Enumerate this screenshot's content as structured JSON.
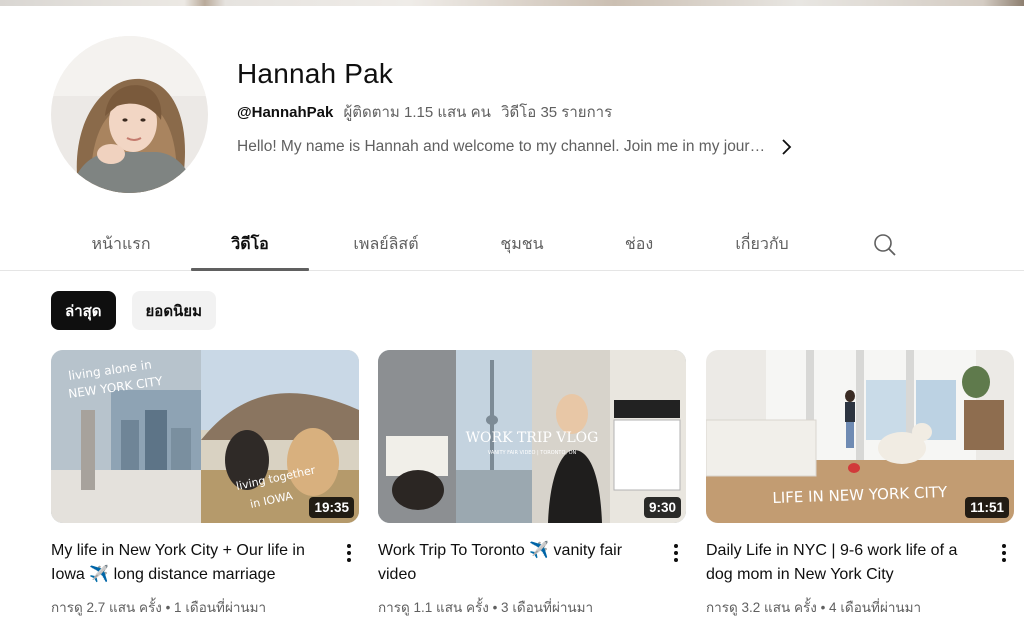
{
  "channel": {
    "name": "Hannah Pak",
    "handle": "@HannahPak",
    "subscribers": "ผู้ติดตาม 1.15 แสน คน",
    "video_count": "วิดีโอ 35 รายการ",
    "description": "Hello! My name is Hannah and welcome to my channel. Join me in my jour…"
  },
  "tabs": [
    {
      "label": "หน้าแรก"
    },
    {
      "label": "วิดีโอ",
      "active": true
    },
    {
      "label": "เพลย์ลิสต์"
    },
    {
      "label": "ชุมชน"
    },
    {
      "label": "ช่อง"
    },
    {
      "label": "เกี่ยวกับ"
    }
  ],
  "chips": [
    {
      "label": "ล่าสุด",
      "active": true
    },
    {
      "label": "ยอดนิยม"
    }
  ],
  "videos": [
    {
      "title": "My life in New York City + Our life in Iowa ✈️ long distance marriage",
      "duration": "19:35",
      "views": "การดู 2.7 แสน ครั้ง",
      "age": "1 เดือนที่ผ่านมา",
      "meta": "การดู 2.7 แสน ครั้ง • 1 เดือนที่ผ่านมา"
    },
    {
      "title": "Work Trip To Toronto ✈️ vanity fair video",
      "duration": "9:30",
      "views": "การดู 1.1 แสน ครั้ง",
      "age": "3 เดือนที่ผ่านมา",
      "meta": "การดู 1.1 แสน ครั้ง • 3 เดือนที่ผ่านมา"
    },
    {
      "title": "Daily Life in NYC | 9-6 work life of a dog mom in New York City",
      "duration": "11:51",
      "views": "การดู 3.2 แสน ครั้ง",
      "age": "4 เดือนที่ผ่านมา",
      "meta": "การดู 3.2 แสน ครั้ง • 4 เดือนที่ผ่านมา"
    }
  ],
  "thumb_text": {
    "v1_top": "living alone in",
    "v1_city": "NEW YORK CITY",
    "v1_bottom1": "living together",
    "v1_bottom2": "in IOWA",
    "v2_title": "WORK TRIP VLOG",
    "v2_sub": "VANITY FAIR VIDEO | TORONTO, ON",
    "v3_text": "LIFE IN NEW YORK CITY"
  },
  "icons": {
    "description_expand": "chevron-right-icon",
    "tab_search": "search-icon",
    "video_menu": "more-vert-icon"
  },
  "colors": {
    "active_chip_bg": "#0f0f0f",
    "chip_bg": "#f2f2f2",
    "secondary_text": "#606060"
  }
}
